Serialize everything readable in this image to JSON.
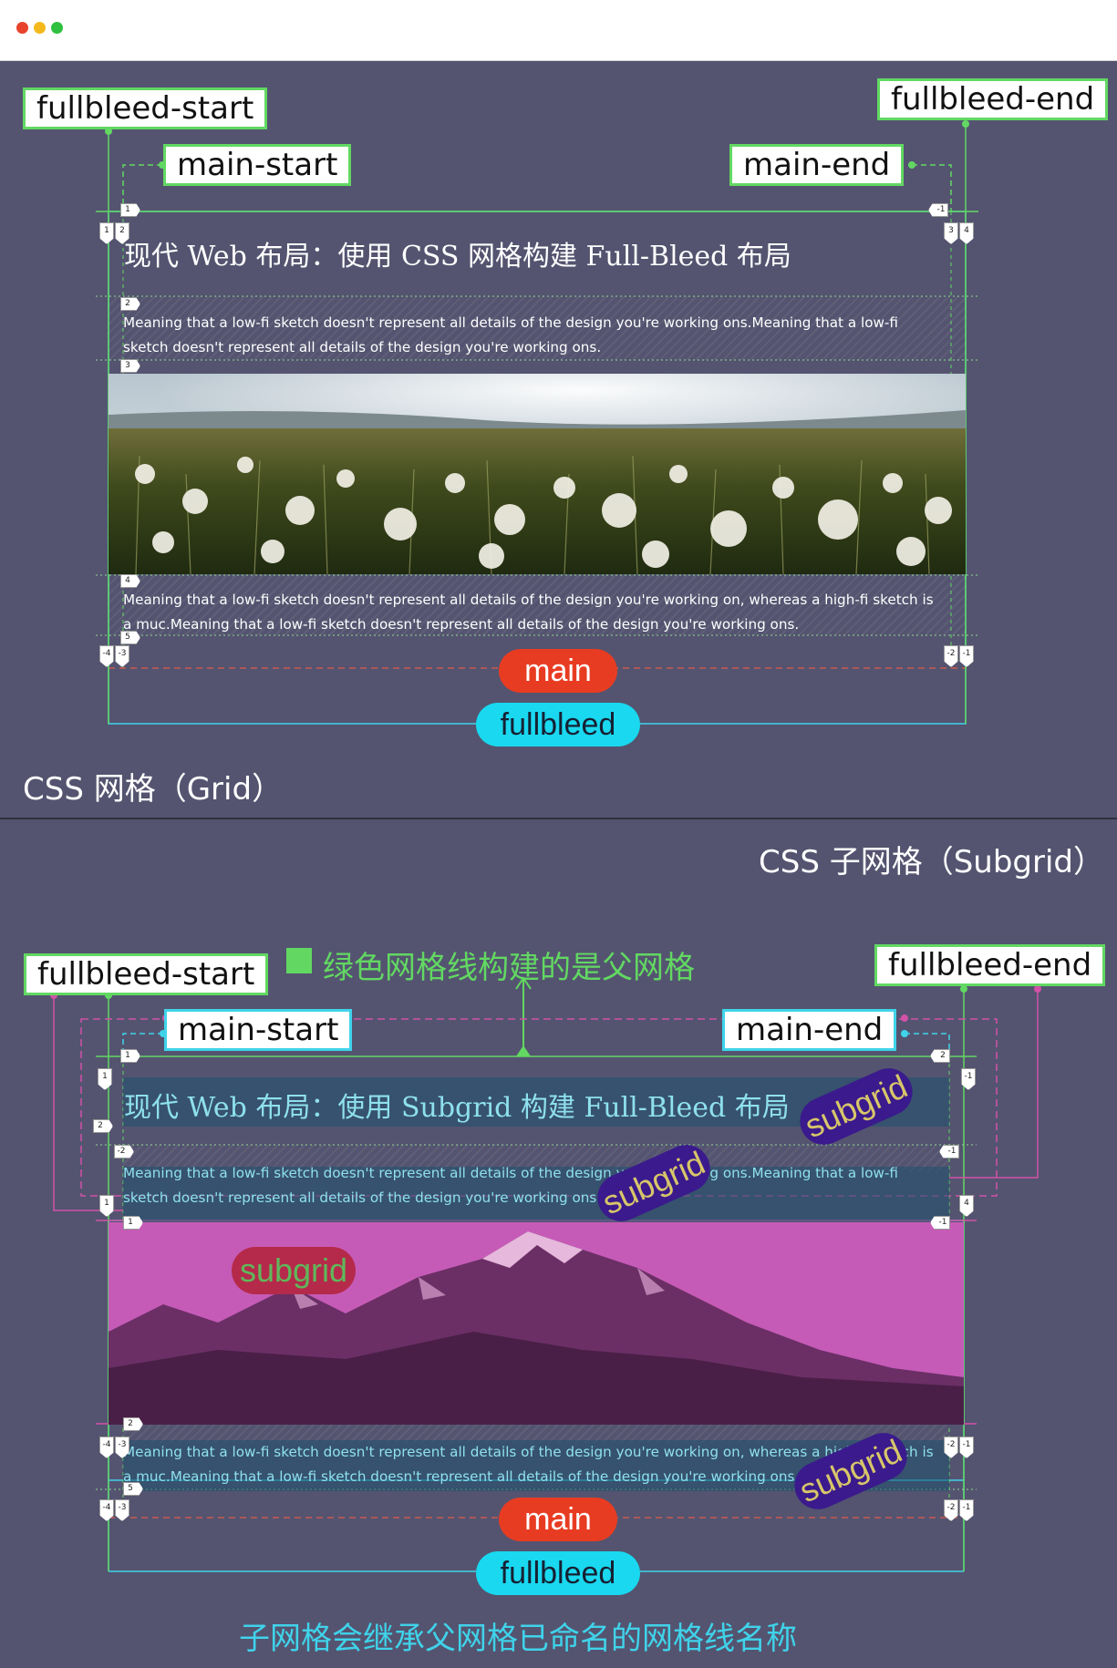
{
  "window": {
    "dots": [
      "#e8432d",
      "#f3b91c",
      "#2fc040"
    ]
  },
  "grid": {
    "labels": {
      "fullbleed_start": "fullbleed-start",
      "fullbleed_end": "fullbleed-end",
      "main_start": "main-start",
      "main_end": "main-end"
    },
    "heading": "现代 Web 布局：使用 CSS 网格构建 Full-Bleed 布局",
    "paragraph1": "Meaning that a low-fi sketch doesn't represent all details of the design you're working ons.Meaning that a low-fi sketch doesn't represent all details of the design you're working ons.",
    "paragraph2": "Meaning that a low-fi sketch doesn't represent all details of the design you're working on, whereas a high-fi sketch is a muc.Meaning that a low-fi sketch doesn't represent all details of the design you're working ons.",
    "area_main": "main",
    "area_fullbleed": "fullbleed",
    "caption": "CSS 网格（Grid）",
    "row_tags": [
      "1",
      "2",
      "3",
      "4",
      "5"
    ],
    "col_tags_left": [
      "1",
      "2"
    ],
    "col_tags_right": [
      "3",
      "4"
    ],
    "neg_tag": "-1",
    "bottom_left": [
      "-4",
      "-3"
    ],
    "bottom_right": [
      "-2",
      "-1"
    ]
  },
  "subgrid": {
    "title": "CSS 子网格（Subgrid）",
    "note": "绿色网格线构建的是父网格",
    "labels": {
      "fullbleed_start": "fullbleed-start",
      "fullbleed_end": "fullbleed-end",
      "main_start": "main-start",
      "main_end": "main-end"
    },
    "heading": "现代 Web 布局：使用 Subgrid 构建 Full-Bleed 布局",
    "paragraph1": "Meaning that a low-fi sketch doesn't represent all details of the design you're working ons.Meaning that a low-fi sketch doesn't represent all details of the design you're working ons.",
    "paragraph2": "Meaning that a low-fi sketch doesn't represent all details of the design you're working on, whereas a high-fi sketch is a muc.Meaning that a low-fi sketch doesn't represent all details of the design you're working ons.",
    "badge": "subgrid",
    "area_main": "main",
    "area_fullbleed": "fullbleed",
    "caption": "子网格会继承父网格已命名的网格线名称",
    "tags": {
      "one": "1",
      "two": "2",
      "three": "3",
      "four": "4",
      "five": "5",
      "neg1": "-1",
      "neg2": "-2",
      "neg3": "-3",
      "neg4": "-4"
    }
  },
  "colors": {
    "bg": "#545470",
    "green": "#62d862",
    "cyan": "#3fd3ea",
    "red": "#e83c22",
    "magenta": "#d252a8",
    "subgrid_badge": "#3a1a8c",
    "caption": "#3fd3ea"
  }
}
